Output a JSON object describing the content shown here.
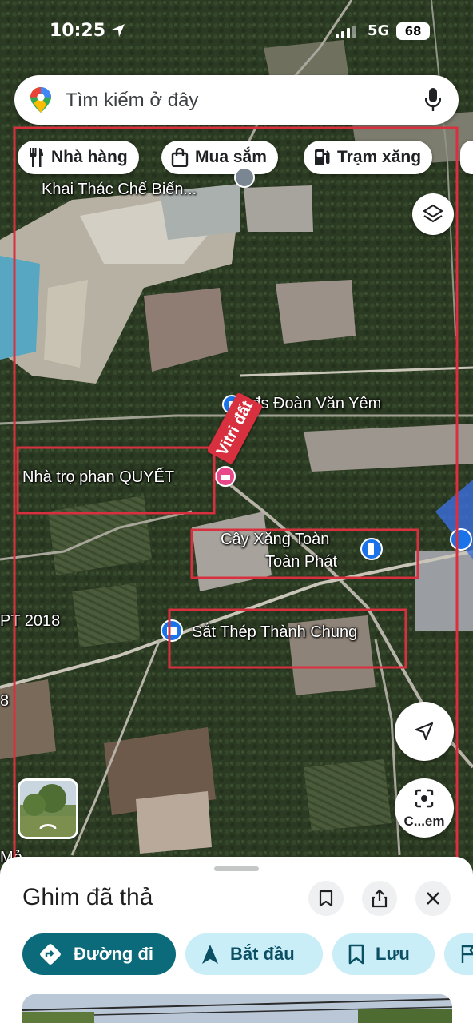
{
  "status_bar": {
    "time": "10:25",
    "network": "5G",
    "battery": "68"
  },
  "search": {
    "placeholder": "Tìm kiếm ở đây"
  },
  "chips": [
    {
      "label": "Nhà hàng",
      "icon": "restaurant-icon"
    },
    {
      "label": "Mua sắm",
      "icon": "shopping-bag-icon"
    },
    {
      "label": "Trạm xăng",
      "icon": "gas-station-icon"
    }
  ],
  "map": {
    "labels": {
      "company": "Khai Thác Chế Biến...",
      "bds": "Bđs Đoàn Văn Yêm",
      "nhatro": "Nhà trọ phan QUYẾT",
      "cayxang_line1": "Cây Xăng Toàn",
      "cayxang_line2": "Toàn Phát",
      "satthep": "Sắt Thép Thành Chung",
      "pt2018": "PT 2018",
      "edge8": "8",
      "edgeM": "Mỏ"
    },
    "marker_label": "Vitri đất",
    "camera_label": "C...em",
    "colors": {
      "annotation": "#d9303f",
      "marker": "#e8488a",
      "poi_blue": "#1a73e8"
    }
  },
  "sheet": {
    "title": "Ghim đã thả",
    "actions": [
      {
        "label": "Đường đi",
        "icon": "directions-icon"
      },
      {
        "label": "Bắt đầu",
        "icon": "navigation-arrow-icon"
      },
      {
        "label": "Lưu",
        "icon": "bookmark-icon"
      }
    ],
    "colors": {
      "primary": "#0b6b7a",
      "secondary_bg": "#c9eef7",
      "secondary_text": "#0b4f63"
    }
  }
}
